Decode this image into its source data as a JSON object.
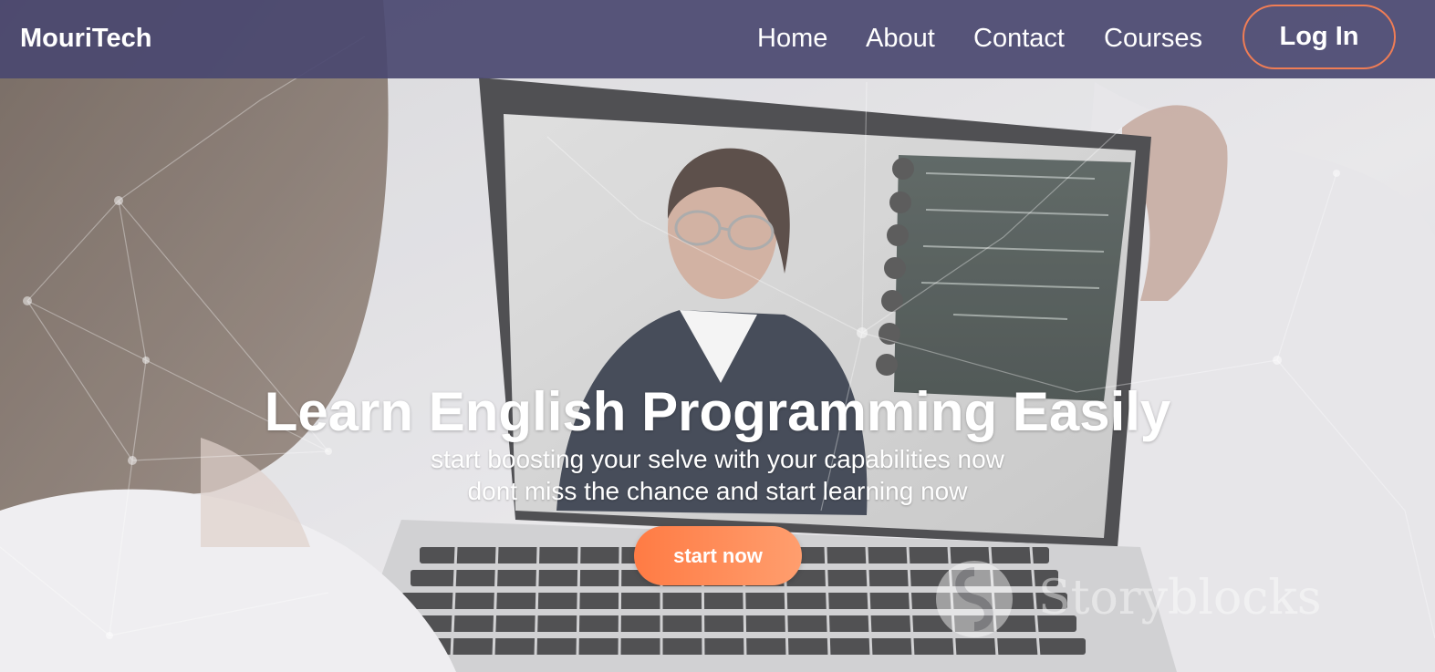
{
  "nav": {
    "brand": "MouriTech",
    "links": [
      "Home",
      "About",
      "Contact",
      "Courses"
    ],
    "login_label": "Log In"
  },
  "hero": {
    "title": "Learn English Programming Easily",
    "subtitle_line1": "start boosting your selve with your capabilities now",
    "subtitle_line2": "dont miss the chance and start learning now",
    "cta_label": "start now"
  },
  "watermark": {
    "text": "Storyblocks"
  },
  "colors": {
    "nav_background": "#4a4870",
    "accent": "#ff7b44",
    "login_border": "#f07d55",
    "text": "#ffffff"
  },
  "icons": [
    "storyblocks-logo-icon"
  ]
}
